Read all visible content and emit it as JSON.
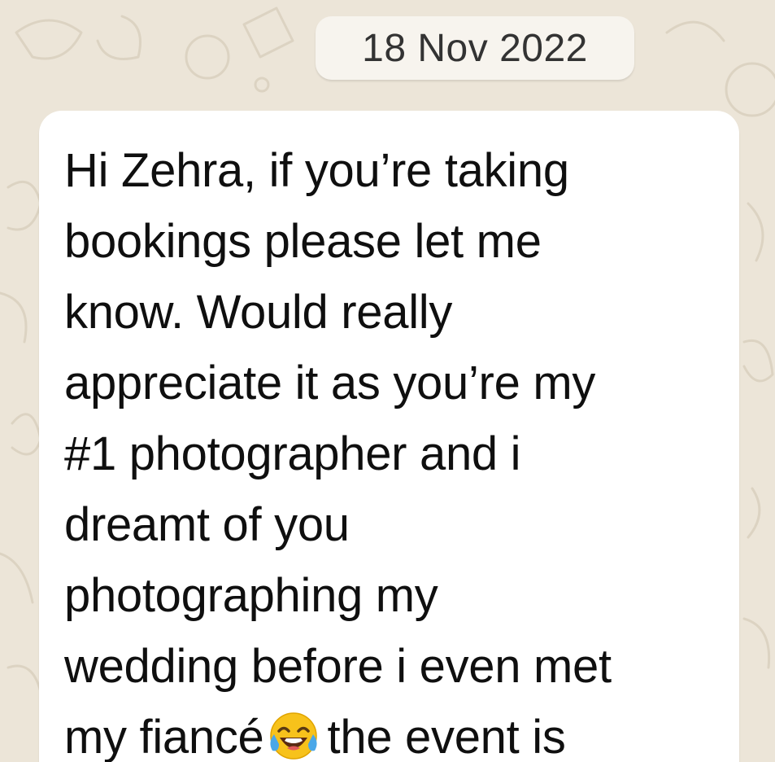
{
  "chat": {
    "date_separator": "18 Nov 2022",
    "message": {
      "lines": [
        "Hi Zehra, if you’re taking",
        "bookings please let me",
        "know. Would really",
        "appreciate it as you’re my",
        "#1 photographer and i",
        "dreamt of you",
        "photographing my",
        "wedding before i even met"
      ],
      "last_line_before_emoji": "my fiancé",
      "last_line_after_emoji": "the event is",
      "emoji": "face-with-tears-of-joy-icon"
    }
  },
  "colors": {
    "wallpaper": "#ece5d8",
    "bubble": "#ffffff",
    "date_chip": "#f7f4ee",
    "text": "#0f0f0f"
  }
}
